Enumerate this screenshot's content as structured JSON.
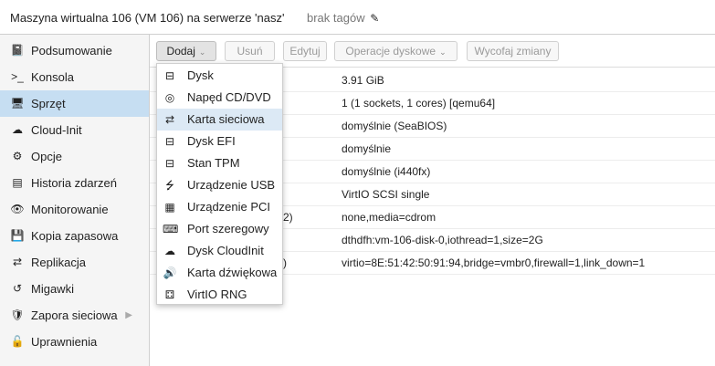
{
  "header": {
    "title": "Maszyna wirtualna 106 (VM 106) na serwerze 'nasz'",
    "tags_label": "brak tagów",
    "edit_icon": "✎"
  },
  "sidebar": {
    "items": [
      {
        "label": "Podsumowanie",
        "icon": "📓"
      },
      {
        "label": "Konsola",
        "icon": ">_"
      },
      {
        "label": "Sprzęt",
        "icon": "🖥"
      },
      {
        "label": "Cloud-Init",
        "icon": "☁"
      },
      {
        "label": "Opcje",
        "icon": "⚙"
      },
      {
        "label": "Historia zdarzeń",
        "icon": "▤"
      },
      {
        "label": "Monitorowanie",
        "icon": "👁"
      },
      {
        "label": "Kopia zapasowa",
        "icon": "💾"
      },
      {
        "label": "Replikacja",
        "icon": "⇄"
      },
      {
        "label": "Migawki",
        "icon": "↺"
      },
      {
        "label": "Zapora sieciowa",
        "icon": "🛡"
      },
      {
        "label": "Uprawnienia",
        "icon": "🔓"
      }
    ],
    "expand_arrow": "▶"
  },
  "toolbar": {
    "add_label": "Dodaj",
    "remove_label": "Usuń",
    "edit_label": "Edytuj",
    "disk_ops_label": "Operacje dyskowe",
    "revert_label": "Wycofaj zmiany",
    "caret": "⌄"
  },
  "hardware": {
    "rows": [
      {
        "key": "",
        "value": "3.91 GiB"
      },
      {
        "key": "",
        "value": "1 (1 sockets, 1 cores) [qemu64]"
      },
      {
        "key": "",
        "value": "domyślnie (SeaBIOS)"
      },
      {
        "key": "",
        "value": "domyślnie"
      },
      {
        "key": "",
        "value": "domyślnie (i440fx)"
      },
      {
        "key": "",
        "value": "VirtIO SCSI single"
      },
      {
        "key": "2)",
        "value": "none,media=cdrom"
      },
      {
        "key": "",
        "value": "dthdfh:vm-106-disk-0,iothread=1,size=2G"
      },
      {
        "key": ")",
        "value": "virtio=8E:51:42:50:91:94,bridge=vmbr0,firewall=1,link_down=1"
      }
    ]
  },
  "add_menu": {
    "items": [
      {
        "label": "Dysk",
        "icon": "⊟"
      },
      {
        "label": "Napęd CD/DVD",
        "icon": "◎"
      },
      {
        "label": "Karta sieciowa",
        "icon": "⇄"
      },
      {
        "label": "Dysk EFI",
        "icon": "⊟"
      },
      {
        "label": "Stan TPM",
        "icon": "⊟"
      },
      {
        "label": "Urządzenie USB",
        "icon": "⭍"
      },
      {
        "label": "Urządzenie PCI",
        "icon": "▦"
      },
      {
        "label": "Port szeregowy",
        "icon": "⌨"
      },
      {
        "label": "Dysk CloudInit",
        "icon": "☁"
      },
      {
        "label": "Karta dźwiękowa",
        "icon": "🔊"
      },
      {
        "label": "VirtIO RNG",
        "icon": "⚃"
      }
    ]
  }
}
